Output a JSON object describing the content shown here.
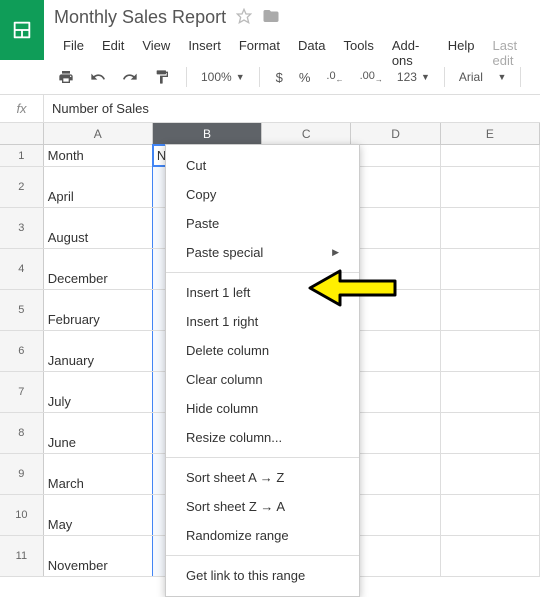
{
  "doc": {
    "title": "Monthly Sales Report"
  },
  "menu": {
    "file": "File",
    "edit": "Edit",
    "view": "View",
    "insert": "Insert",
    "format": "Format",
    "data": "Data",
    "tools": "Tools",
    "addons": "Add-ons",
    "help": "Help",
    "last_edit": "Last edit"
  },
  "toolbar": {
    "zoom": "100%",
    "currency": "$",
    "percent": "%",
    "dec_dec": ".0",
    "inc_dec": ".00",
    "numfmt": "123",
    "font": "Arial"
  },
  "fx": {
    "label": "fx",
    "value": "Number of Sales"
  },
  "colHeaders": [
    "A",
    "B",
    "C",
    "D",
    "E"
  ],
  "rows": [
    {
      "n": "1",
      "a": "Month",
      "b": "Number of Sales"
    },
    {
      "n": "2",
      "a": "April",
      "b": ""
    },
    {
      "n": "3",
      "a": "August",
      "b": ""
    },
    {
      "n": "4",
      "a": "December",
      "b": ""
    },
    {
      "n": "5",
      "a": "February",
      "b": ""
    },
    {
      "n": "6",
      "a": "January",
      "b": ""
    },
    {
      "n": "7",
      "a": "July",
      "b": ""
    },
    {
      "n": "8",
      "a": "June",
      "b": ""
    },
    {
      "n": "9",
      "a": "March",
      "b": ""
    },
    {
      "n": "10",
      "a": "May",
      "b": ""
    },
    {
      "n": "11",
      "a": "November",
      "b": ""
    }
  ],
  "context_menu": {
    "cut": "Cut",
    "copy": "Copy",
    "paste": "Paste",
    "paste_special": "Paste special",
    "insert_left": "Insert 1 left",
    "insert_right": "Insert 1 right",
    "delete_col": "Delete column",
    "clear_col": "Clear column",
    "hide_col": "Hide column",
    "resize_col": "Resize column...",
    "sort_az": "Sort sheet A → Z",
    "sort_za": "Sort sheet Z → A",
    "randomize": "Randomize range",
    "get_link": "Get link to this range"
  }
}
